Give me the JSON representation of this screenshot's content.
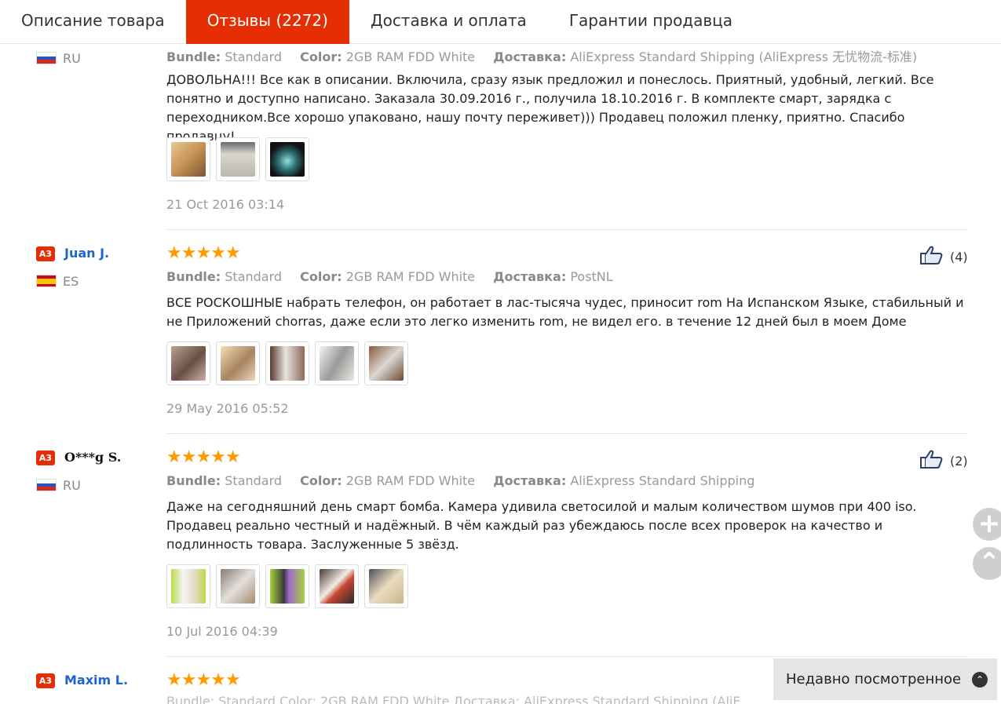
{
  "tabs": [
    {
      "label": "Описание товара"
    },
    {
      "label": "Отзывы (2272)"
    },
    {
      "label": "Доставка и оплата"
    },
    {
      "label": "Гарантии продавца"
    }
  ],
  "meta_labels": {
    "bundle": "Bundle:",
    "color": "Color:",
    "delivery": "Доставка:"
  },
  "reviews": [
    {
      "country": "RU",
      "bundle": "Standard",
      "color": "2GB RAM FDD White",
      "delivery": "AliExpress Standard Shipping (AliExpress 无忧物流-标准)",
      "text": "ДОВОЛЬНА!!! Все как в описании. Включила, сразу язык предложил и понеслось. Приятный, удобный, легкий. Все понятно и доступно написано. Заказала 30.09.2016 г., получила 18.10.2016 г. В комплекте смарт, зарядка с переходником.Все хорошо упаковано, нашу почту переживет))) Продавец положил пленку, приятно. Спасибо продавцу!",
      "date": "21 Oct 2016 03:14"
    },
    {
      "badge": "A3",
      "name": "Juan J.",
      "country": "ES",
      "stars": "★★★★★",
      "likes": "(4)",
      "bundle": "Standard",
      "color": "2GB RAM FDD White",
      "delivery": "PostNL",
      "text": "ВСЕ РОСКОШНЫЕ набрать телефон, он работает в лас-тысяча чудес, приносит rom На Испанском Языке, стабильный и не Приложений chorras, даже если это легко изменить rom, не видел его. в течение 12 дней был в моем Доме",
      "date": "29 May 2016 05:52"
    },
    {
      "badge": "A3",
      "name": "O***g S.",
      "country": "RU",
      "stars": "★★★★★",
      "likes": "(2)",
      "bundle": "Standard",
      "color": "2GB RAM FDD White",
      "delivery": "AliExpress Standard Shipping",
      "text": "Даже на сегодняшний день смарт бомба. Камера удивила светосилой и малым количеством шумов при 400 iso. Продавец реально честный и надёжный. В чём каждый раз убеждаюсь после всех проверок на качество и подлинность товара. Заслуженные 5 звёзд.",
      "date": "10 Jul 2016 04:39"
    },
    {
      "badge": "A3",
      "name": "Maxim L.",
      "stars": "★★★★★"
    }
  ],
  "cut_line": "Bundle: Standard   Color: 2GB RAM FDD White   Доставка: AliExpress Standard Shipping (AliE",
  "fab": {
    "plus": "+",
    "up": "⌃"
  },
  "recent": {
    "label": "Недавно посмотренное",
    "chevron": "⌃"
  }
}
